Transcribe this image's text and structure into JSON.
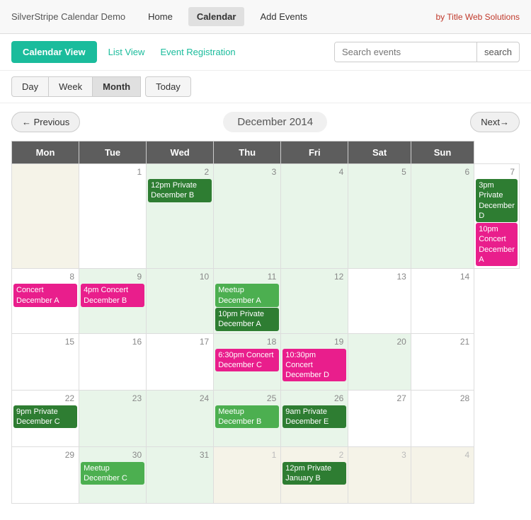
{
  "topNav": {
    "brand": "SilverStripe Calendar Demo",
    "links": [
      "Home",
      "Calendar",
      "Add Events"
    ],
    "activeLink": "Calendar",
    "byTitle": "by Title Web Solutions"
  },
  "subNav": {
    "calendarView": "Calendar View",
    "listView": "List View",
    "eventRegistration": "Event Registration",
    "searchPlaceholder": "Search events",
    "searchBtn": "search"
  },
  "viewButtons": {
    "day": "Day",
    "week": "Week",
    "month": "Month",
    "today": "Today"
  },
  "navRow": {
    "previous": "← Previous",
    "monthLabel": "December 2014",
    "next": "Next→"
  },
  "weekdays": [
    "Mon",
    "Tue",
    "Wed",
    "Thu",
    "Fri",
    "Sat",
    "Sun"
  ],
  "weeks": [
    {
      "days": [
        {
          "num": "",
          "otherMonth": true,
          "lightGreen": false,
          "events": []
        },
        {
          "num": "1",
          "otherMonth": false,
          "lightGreen": false,
          "events": []
        },
        {
          "num": "2",
          "otherMonth": false,
          "lightGreen": true,
          "events": [
            {
              "text": "12pm Private December B",
              "type": "dark-green"
            }
          ]
        },
        {
          "num": "3",
          "otherMonth": false,
          "lightGreen": true,
          "events": []
        },
        {
          "num": "4",
          "otherMonth": false,
          "lightGreen": true,
          "events": []
        },
        {
          "num": "5",
          "otherMonth": false,
          "lightGreen": true,
          "events": []
        },
        {
          "num": "6",
          "otherMonth": false,
          "lightGreen": true,
          "events": []
        },
        {
          "num": "7",
          "otherMonth": false,
          "lightGreen": false,
          "events": [
            {
              "text": "3pm Private December D",
              "type": "dark-green"
            },
            {
              "text": "10pm Concert December A",
              "type": "magenta"
            }
          ]
        }
      ]
    },
    {
      "days": [
        {
          "num": "8",
          "otherMonth": false,
          "lightGreen": false,
          "events": [
            {
              "text": "Concert December A",
              "type": "magenta"
            }
          ]
        },
        {
          "num": "9",
          "otherMonth": false,
          "lightGreen": true,
          "events": [
            {
              "text": "4pm Concert December B",
              "type": "magenta"
            }
          ]
        },
        {
          "num": "10",
          "otherMonth": false,
          "lightGreen": true,
          "events": []
        },
        {
          "num": "11",
          "otherMonth": false,
          "lightGreen": true,
          "events": [
            {
              "text": "Meetup December A",
              "type": "bright-green"
            },
            {
              "text": "10pm Private December A",
              "type": "dark-green"
            }
          ]
        },
        {
          "num": "12",
          "otherMonth": false,
          "lightGreen": true,
          "events": []
        },
        {
          "num": "13",
          "otherMonth": false,
          "lightGreen": false,
          "events": []
        },
        {
          "num": "14",
          "otherMonth": false,
          "lightGreen": false,
          "events": []
        }
      ]
    },
    {
      "days": [
        {
          "num": "15",
          "otherMonth": false,
          "lightGreen": false,
          "events": []
        },
        {
          "num": "16",
          "otherMonth": false,
          "lightGreen": false,
          "events": []
        },
        {
          "num": "17",
          "otherMonth": false,
          "lightGreen": false,
          "events": []
        },
        {
          "num": "18",
          "otherMonth": false,
          "lightGreen": true,
          "events": [
            {
              "text": "6:30pm Concert December C",
              "type": "magenta"
            }
          ]
        },
        {
          "num": "19",
          "otherMonth": false,
          "lightGreen": true,
          "events": [
            {
              "text": "10:30pm Concert December D",
              "type": "magenta"
            }
          ]
        },
        {
          "num": "20",
          "otherMonth": false,
          "lightGreen": true,
          "events": []
        },
        {
          "num": "21",
          "otherMonth": false,
          "lightGreen": false,
          "events": []
        }
      ]
    },
    {
      "days": [
        {
          "num": "22",
          "otherMonth": false,
          "lightGreen": false,
          "events": [
            {
              "text": "9pm Private December C",
              "type": "dark-green"
            }
          ]
        },
        {
          "num": "23",
          "otherMonth": false,
          "lightGreen": true,
          "events": []
        },
        {
          "num": "24",
          "otherMonth": false,
          "lightGreen": true,
          "events": []
        },
        {
          "num": "25",
          "otherMonth": false,
          "lightGreen": true,
          "events": [
            {
              "text": "Meetup December B",
              "type": "bright-green"
            }
          ]
        },
        {
          "num": "26",
          "otherMonth": false,
          "lightGreen": true,
          "events": [
            {
              "text": "9am Private December E",
              "type": "dark-green"
            }
          ]
        },
        {
          "num": "27",
          "otherMonth": false,
          "lightGreen": false,
          "events": []
        },
        {
          "num": "28",
          "otherMonth": false,
          "lightGreen": false,
          "events": []
        }
      ]
    },
    {
      "days": [
        {
          "num": "29",
          "otherMonth": false,
          "lightGreen": false,
          "events": []
        },
        {
          "num": "30",
          "otherMonth": false,
          "lightGreen": true,
          "events": [
            {
              "text": "Meetup December C",
              "type": "bright-green"
            }
          ]
        },
        {
          "num": "31",
          "otherMonth": false,
          "lightGreen": true,
          "events": []
        },
        {
          "num": "1",
          "otherMonth": true,
          "lightGreen": false,
          "events": []
        },
        {
          "num": "2",
          "otherMonth": true,
          "lightGreen": false,
          "events": [
            {
              "text": "12pm Private January B",
              "type": "dark-green"
            }
          ]
        },
        {
          "num": "3",
          "otherMonth": true,
          "lightGreen": false,
          "events": []
        },
        {
          "num": "4",
          "otherMonth": true,
          "lightGreen": false,
          "events": []
        }
      ]
    }
  ]
}
